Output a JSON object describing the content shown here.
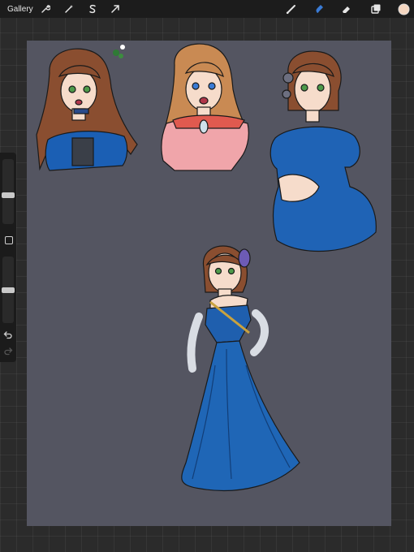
{
  "topbar": {
    "gallery_label": "Gallery",
    "icons": [
      "wrench-icon",
      "magic-wand-icon",
      "selection-s-icon",
      "arrow-transform-icon",
      "brush-icon",
      "smudge-icon",
      "eraser-icon",
      "layers-icon",
      "color-swatch-icon"
    ],
    "active_tool": "smudge",
    "current_color": "#f4d6c0",
    "accent": "#3a7bd5"
  },
  "sidebar": {
    "brush_size_slider": 0.7,
    "opacity_slider": 0.45,
    "icons": [
      "modify-square-icon",
      "undo-icon",
      "redo-icon"
    ]
  },
  "canvas": {
    "background": "#545561",
    "artwork": [
      "girl-brown-hair-blue-offshoulder",
      "girl-blonde-pink-dress",
      "girl-brunette-blue-dress-bust",
      "girl-full-body-blue-gown"
    ]
  }
}
